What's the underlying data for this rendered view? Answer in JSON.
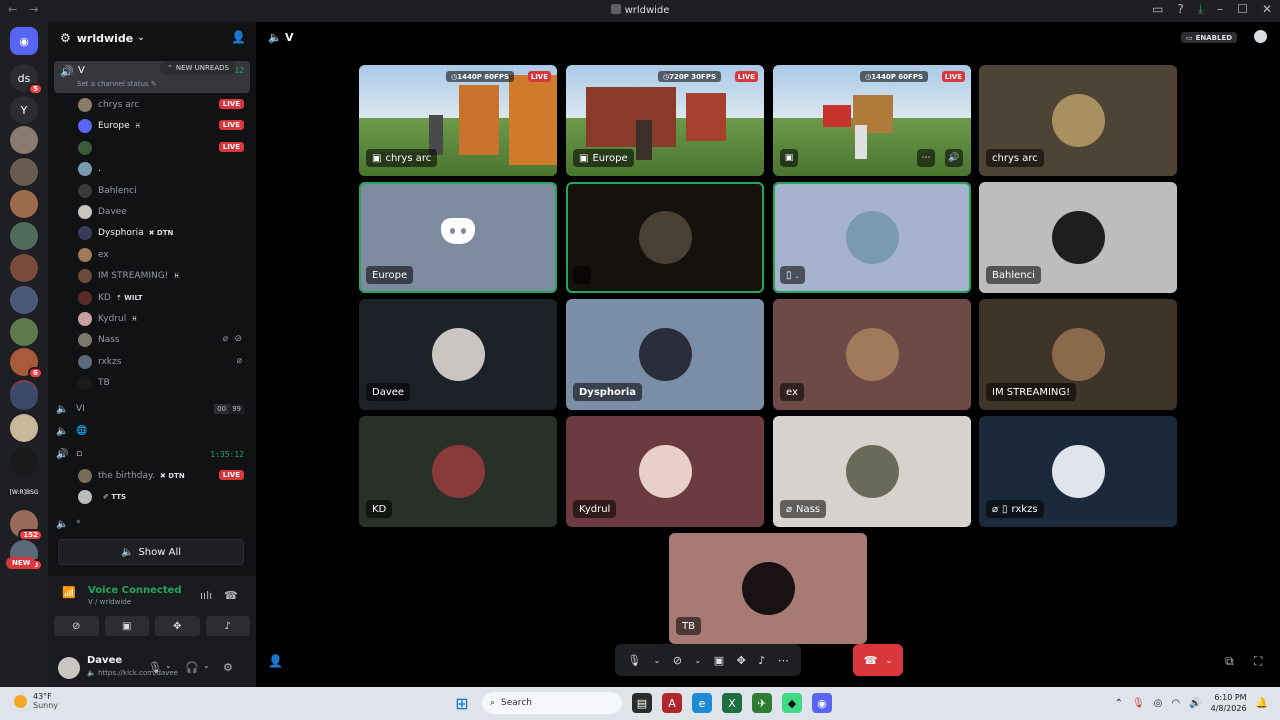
{
  "window": {
    "title": "wrldwide"
  },
  "rail": {
    "items": [
      {
        "label": "",
        "color": "#5865f2"
      },
      {
        "label": "ds",
        "color": "#2b2d31",
        "badge": "5"
      },
      {
        "label": "Y",
        "color": "#2b2d31"
      },
      {
        "label": "",
        "color": "#8a7b70"
      },
      {
        "label": "",
        "color": "#6b5a4e"
      },
      {
        "label": "",
        "color": "#9b6b4a"
      },
      {
        "label": "",
        "color": "#4f6a5a"
      },
      {
        "label": "",
        "color": "#7a4a3a"
      },
      {
        "label": "",
        "color": "#4a5a7a"
      },
      {
        "label": "",
        "color": "#5d7a4a"
      },
      {
        "label": "",
        "color": "#a85a3a",
        "badge": "6"
      },
      {
        "label": "",
        "color": "#8a3a4a"
      },
      {
        "label": "",
        "color": "#3a4a6a"
      },
      {
        "label": "",
        "color": "#c8b89a"
      },
      {
        "label": "",
        "color": "#1a1a1a"
      },
      {
        "label": "[W:R]BSG",
        "color": "#1e1f22"
      },
      {
        "label": "",
        "color": "#9a6a5a",
        "badge": "152"
      },
      {
        "label": "",
        "color": "#5a6a7a",
        "badge": "20"
      }
    ],
    "new_label": "NEW"
  },
  "server": {
    "name": "wrldwide"
  },
  "channel_v": {
    "name": "V",
    "status_placeholder": "Set a channel status",
    "timer": "5:29:12",
    "new_unreads": "NEW UNREADS"
  },
  "members": [
    {
      "name": "chrys arc",
      "live": true,
      "color": "#8a7b6a",
      "bright": false
    },
    {
      "name": "Europe",
      "tag": "♓",
      "live": true,
      "color": "#5865f2",
      "bright": true
    },
    {
      "name": "",
      "live": true,
      "color": "#3a5a3a",
      "bright": false
    },
    {
      "name": ".",
      "live": false,
      "color": "#7a9ab0",
      "bright": true
    },
    {
      "name": "Bahlenci",
      "live": false,
      "color": "#3a3a3a",
      "bright": false
    },
    {
      "name": "Davee",
      "live": false,
      "color": "#c9c6c2",
      "bright": false
    },
    {
      "name": "Dysphoria",
      "tag": "DTN",
      "live": false,
      "color": "#3a3a5a",
      "bright": true
    },
    {
      "name": "ex",
      "live": false,
      "color": "#a07a5a",
      "bright": false
    },
    {
      "name": "IM STREAMING!",
      "tag": "♓",
      "live": false,
      "color": "#6a4a3a",
      "bright": false
    },
    {
      "name": "KD",
      "tag": "WILT",
      "live": false,
      "color": "#5a2a2a",
      "bright": false
    },
    {
      "name": "Kydrul",
      "tag": "♓",
      "live": false,
      "color": "#c8a0a0",
      "bright": false
    },
    {
      "name": "Nass",
      "live": false,
      "color": "#7a7a6a",
      "bright": false,
      "mic_muted": true,
      "deafened": true
    },
    {
      "name": "rxkzs",
      "live": false,
      "color": "#5a6a7a",
      "bright": false,
      "mic_muted": true
    },
    {
      "name": "TB",
      "live": false,
      "color": "#1a1a1a",
      "bright": false
    }
  ],
  "channels": [
    {
      "name": "VI",
      "counts": [
        "00",
        "99"
      ]
    },
    {
      "name": "🌐"
    },
    {
      "name": "▫",
      "timer": "1:35:12"
    }
  ],
  "birthday_members": [
    {
      "name": "the birthday.",
      "tag": "DTN",
      "live": true
    },
    {
      "name": "",
      "tag": "TTS",
      "live": false
    }
  ],
  "channel_last": {
    "name": "*"
  },
  "show_all": "Show All",
  "voice": {
    "status": "Voice Connected",
    "location": "V / wrldwide"
  },
  "user": {
    "name": "Davee",
    "status": "https://kick.com/davee"
  },
  "header": {
    "channel": "V",
    "enabled": "ENABLED"
  },
  "tiles": [
    {
      "label": "chrys arc",
      "type": "stream",
      "res": "1440P 60FPS",
      "live": "LIVE"
    },
    {
      "label": "Europe",
      "type": "stream",
      "res": "720P 30FPS",
      "live": "LIVE"
    },
    {
      "label": "",
      "type": "stream",
      "res": "1440P 60FPS",
      "live": "LIVE"
    },
    {
      "label": "chrys arc",
      "type": "avatar",
      "bg": "#4e4436",
      "avatar": "#a89060"
    },
    {
      "label": "Europe",
      "type": "discord",
      "bg": "#7e8aa0",
      "speaking": true
    },
    {
      "label": "",
      "type": "avatar",
      "bg": "#15110c",
      "avatar": "#4a4035",
      "speaking": true
    },
    {
      "label": ".",
      "type": "avatar",
      "bg": "#a7b2cf",
      "avatar": "#7a9ab0",
      "speaking": true
    },
    {
      "label": "Bahlenci",
      "type": "avatar",
      "bg": "#bdbdbd",
      "avatar": "#1e1e1e"
    },
    {
      "label": "Davee",
      "type": "avatar",
      "bg": "#1d2128",
      "avatar": "#c9c6c2"
    },
    {
      "label": "Dysphoria",
      "type": "avatar",
      "bg": "#7a8ea8",
      "avatar": "#2a2e3a"
    },
    {
      "label": "ex",
      "type": "avatar",
      "bg": "#6d4a48",
      "avatar": "#a07a5a"
    },
    {
      "label": "IM STREAMING!",
      "type": "avatar",
      "bg": "#3e342a",
      "avatar": "#8a6a4a"
    },
    {
      "label": "KD",
      "type": "avatar",
      "bg": "#283028",
      "avatar": "#8a3a3a"
    },
    {
      "label": "Kydrul",
      "type": "avatar",
      "bg": "#6c3b3f",
      "avatar": "#e8d0c8"
    },
    {
      "label": "Nass",
      "type": "avatar",
      "bg": "#d6d3cf",
      "avatar": "#6a6a5a"
    },
    {
      "label": "rxkzs",
      "type": "avatar",
      "bg": "#1b2a3a",
      "avatar": "#dfe3ea"
    },
    {
      "label": "TB",
      "type": "avatar",
      "bg": "#a77b74",
      "avatar": "#1a1212"
    }
  ],
  "taskbar": {
    "temp": "43°F",
    "weather": "Sunny",
    "search": "Search",
    "time": "6:10 PM",
    "date": "4/8/2026"
  }
}
